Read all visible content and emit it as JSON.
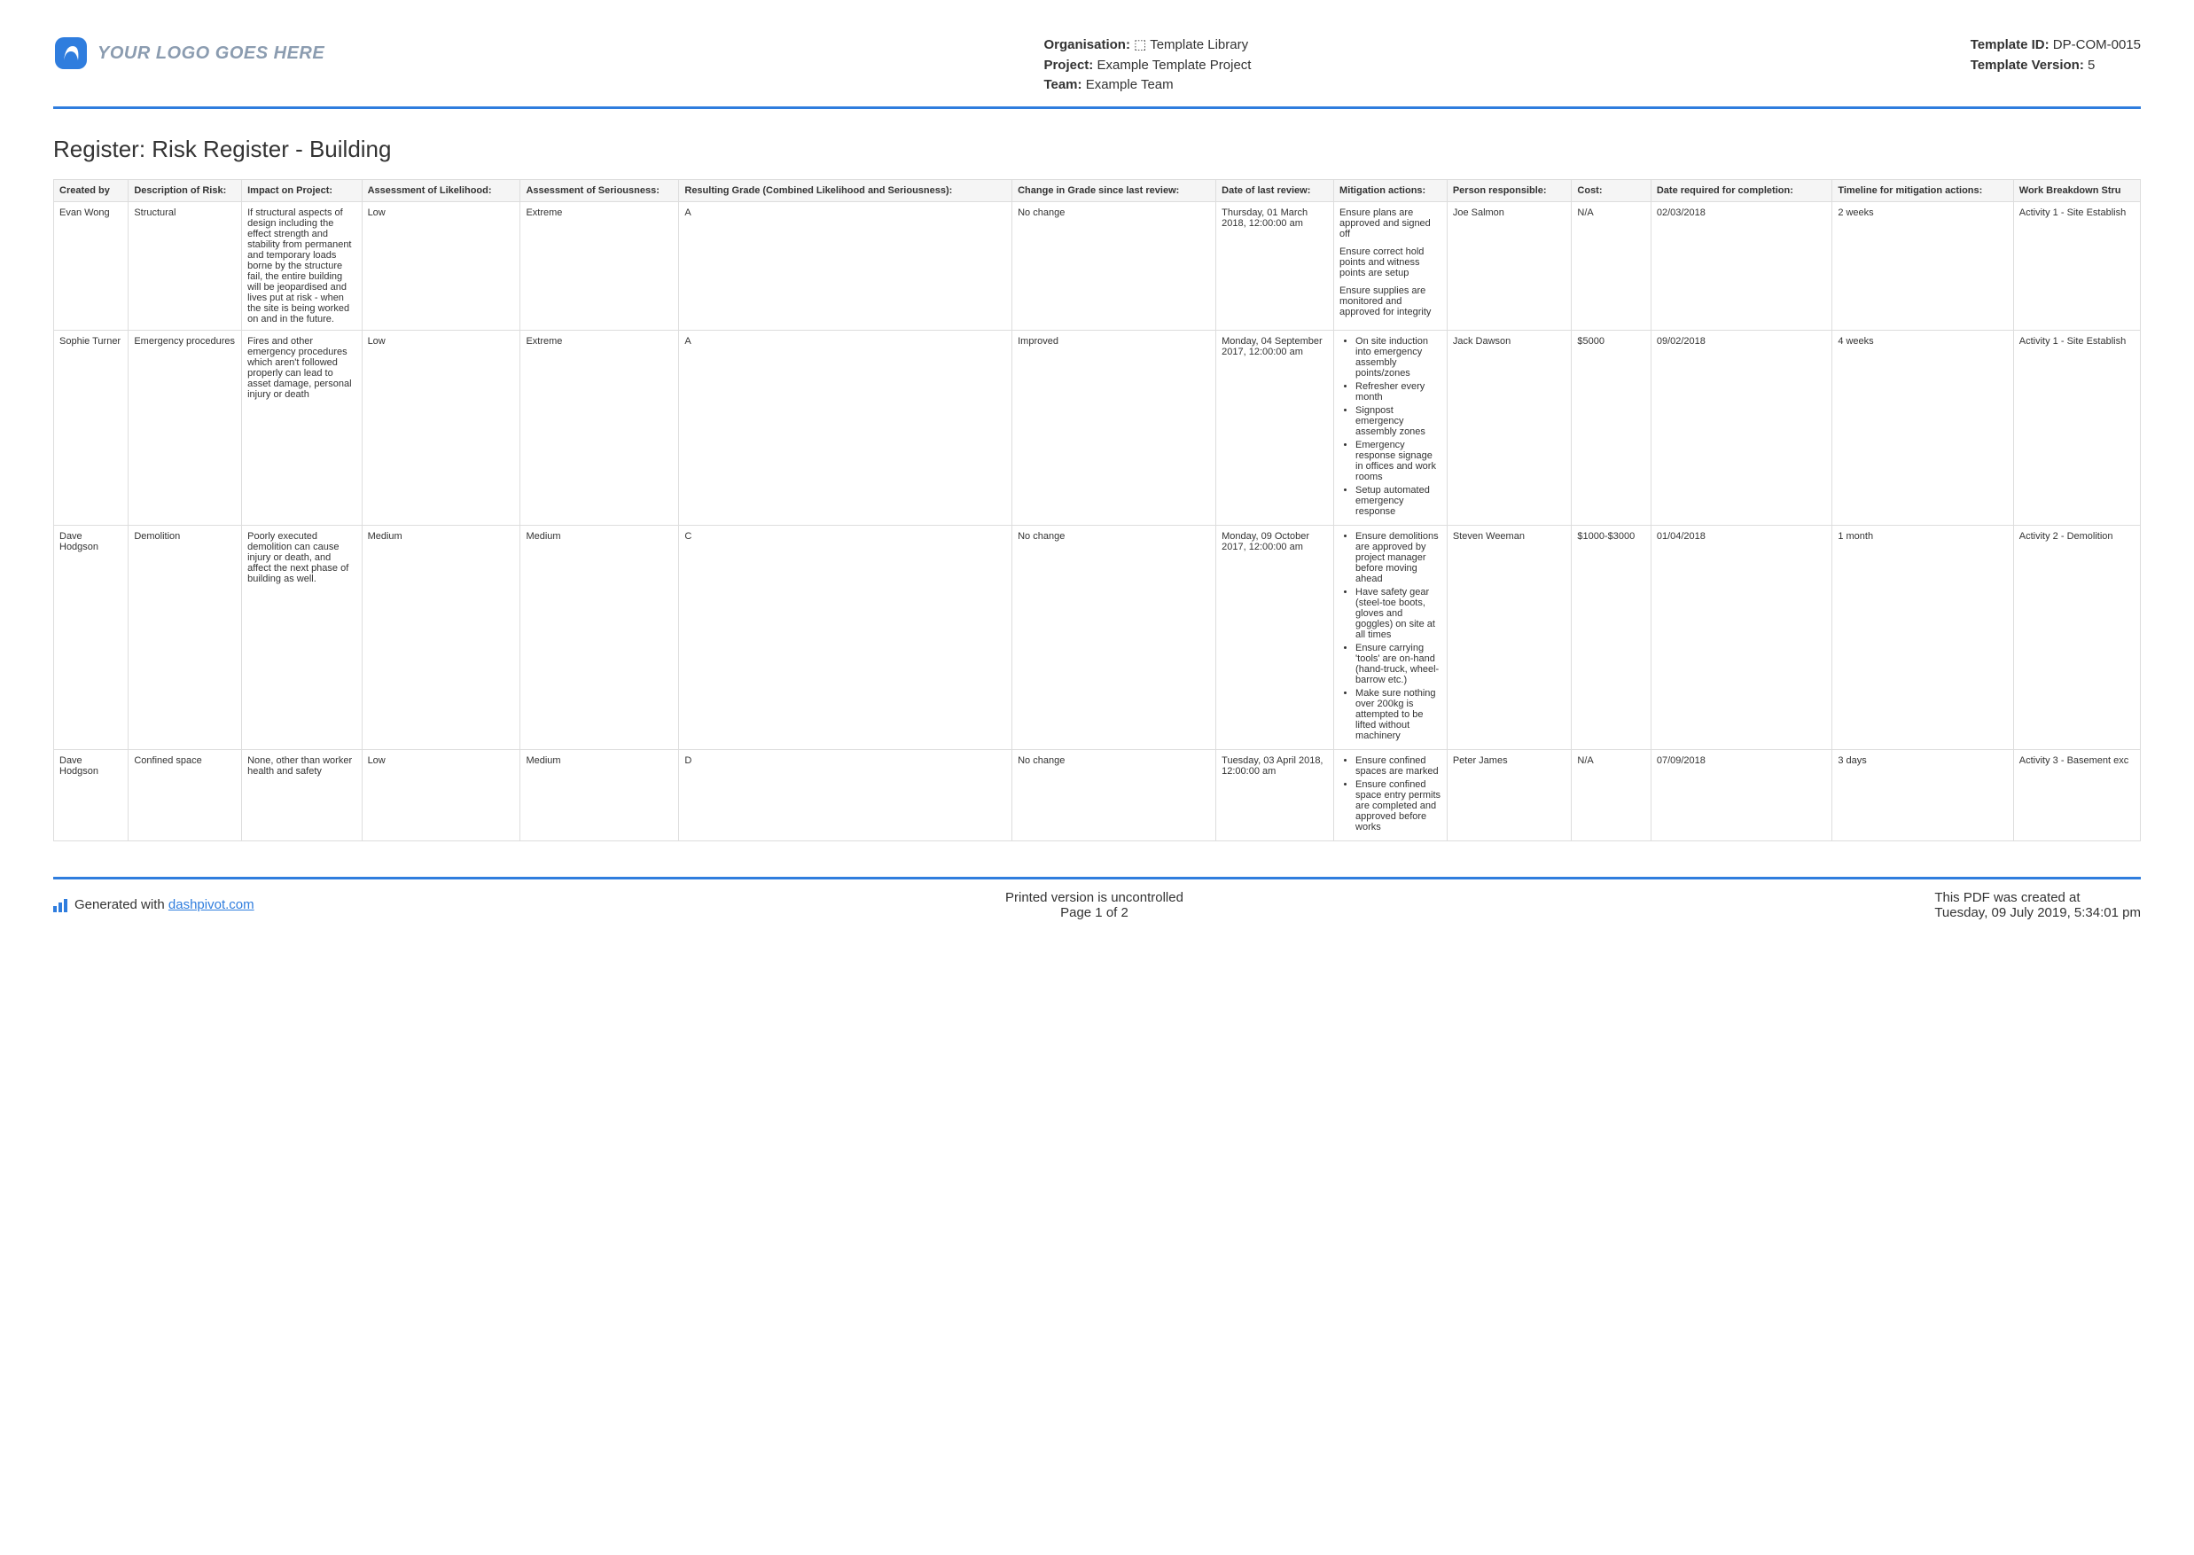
{
  "header": {
    "logo_text": "YOUR LOGO GOES HERE",
    "org_label": "Organisation:",
    "org_value": "⬚ Template Library",
    "project_label": "Project:",
    "project_value": "Example Template Project",
    "team_label": "Team:",
    "team_value": "Example Team",
    "template_id_label": "Template ID:",
    "template_id_value": "DP-COM-0015",
    "template_ver_label": "Template Version:",
    "template_ver_value": "5"
  },
  "title": "Register: Risk Register - Building",
  "columns": [
    "Created by",
    "Description of Risk:",
    "Impact on Project:",
    "Assessment of Likelihood:",
    "Assessment of Seriousness:",
    "Resulting Grade (Combined Likelihood and Seriousness):",
    "Change in Grade since last review:",
    "Date of last review:",
    "Mitigation actions:",
    "Person responsible:",
    "Cost:",
    "Date required for completion:",
    "Timeline for mitigation actions:",
    "Work Breakdown Stru"
  ],
  "rows": [
    {
      "created_by": "Evan Wong",
      "description": "Structural",
      "impact": "If structural aspects of design including the effect strength and stability from permanent and temporary loads borne by the structure fail, the entire building will be jeopardised and lives put at risk - when the site is being worked on and in the future.",
      "likelihood": "Low",
      "seriousness": "Extreme",
      "grade": "A",
      "change": "No change",
      "last_review": "Thursday, 01 March 2018, 12:00:00 am",
      "mitigation_text": "Ensure plans are approved and signed off\n\nEnsure correct hold points and witness points are setup\n\nEnsure supplies are monitored and approved for integrity",
      "person": "Joe Salmon",
      "cost": "N/A",
      "completion": "02/03/2018",
      "timeline": "2 weeks",
      "wbs": "Activity 1 - Site Establish"
    },
    {
      "created_by": "Sophie Turner",
      "description": "Emergency procedures",
      "impact": "Fires and other emergency procedures which aren't followed properly can lead to asset damage, personal injury or death",
      "likelihood": "Low",
      "seriousness": "Extreme",
      "grade": "A",
      "change": "Improved",
      "last_review": "Monday, 04 September 2017, 12:00:00 am",
      "mitigation_list": [
        "On site induction into emergency assembly points/zones",
        "Refresher every month",
        "Signpost emergency assembly zones",
        "Emergency response signage in offices and work rooms",
        "Setup automated emergency response"
      ],
      "person": "Jack Dawson",
      "cost": "$5000",
      "completion": "09/02/2018",
      "timeline": "4 weeks",
      "wbs": "Activity 1 - Site Establish"
    },
    {
      "created_by": "Dave Hodgson",
      "description": "Demolition",
      "impact": "Poorly executed demolition can cause injury or death, and affect the next phase of building as well.",
      "likelihood": "Medium",
      "seriousness": "Medium",
      "grade": "C",
      "change": "No change",
      "last_review": "Monday, 09 October 2017, 12:00:00 am",
      "mitigation_list": [
        "Ensure demolitions are approved by project manager before moving ahead",
        "Have safety gear (steel-toe boots, gloves and goggles) on site at all times",
        "Ensure carrying 'tools' are on-hand (hand-truck, wheel-barrow etc.)",
        "Make sure nothing over 200kg is attempted to be lifted without machinery"
      ],
      "person": "Steven Weeman",
      "cost": "$1000-$3000",
      "completion": "01/04/2018",
      "timeline": "1 month",
      "wbs": "Activity 2 - Demolition"
    },
    {
      "created_by": "Dave Hodgson",
      "description": "Confined space",
      "impact": "None, other than worker health and safety",
      "likelihood": "Low",
      "seriousness": "Medium",
      "grade": "D",
      "change": "No change",
      "last_review": "Tuesday, 03 April 2018, 12:00:00 am",
      "mitigation_list": [
        "Ensure confined spaces are marked",
        "Ensure confined space entry permits are completed and approved before works"
      ],
      "person": "Peter James",
      "cost": "N/A",
      "completion": "07/09/2018",
      "timeline": "3 days",
      "wbs": "Activity 3 - Basement exc"
    }
  ],
  "footer": {
    "generated_prefix": "Generated with ",
    "generated_link": "dashpivot.com",
    "uncontrolled": "Printed version is uncontrolled",
    "page": "Page 1 of 2",
    "created_label": "This PDF was created at",
    "created_value": "Tuesday, 09 July 2019, 5:34:01 pm"
  }
}
